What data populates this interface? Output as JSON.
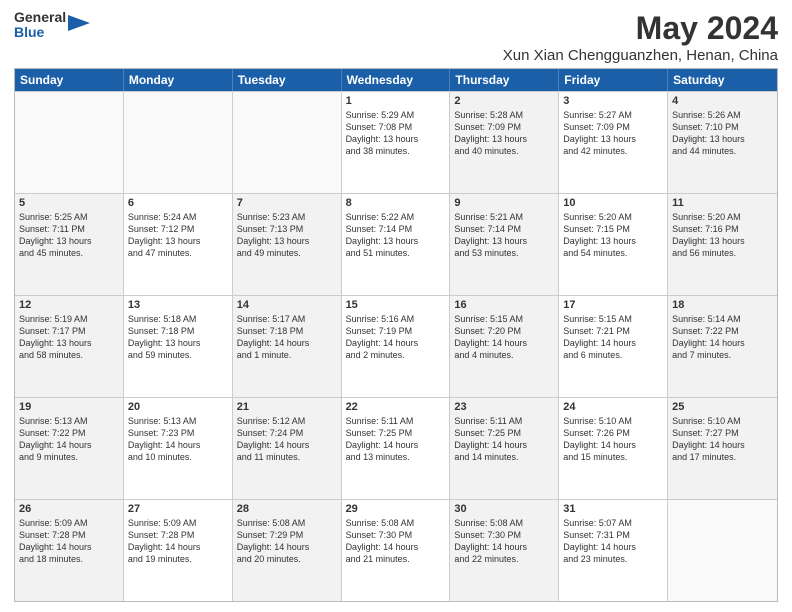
{
  "logo": {
    "general": "General",
    "blue": "Blue"
  },
  "title": "May 2024",
  "subtitle": "Xun Xian Chengguanzhen, Henan, China",
  "headers": [
    "Sunday",
    "Monday",
    "Tuesday",
    "Wednesday",
    "Thursday",
    "Friday",
    "Saturday"
  ],
  "rows": [
    [
      {
        "day": "",
        "text": ""
      },
      {
        "day": "",
        "text": ""
      },
      {
        "day": "",
        "text": ""
      },
      {
        "day": "1",
        "text": "Sunrise: 5:29 AM\nSunset: 7:08 PM\nDaylight: 13 hours\nand 38 minutes."
      },
      {
        "day": "2",
        "text": "Sunrise: 5:28 AM\nSunset: 7:09 PM\nDaylight: 13 hours\nand 40 minutes."
      },
      {
        "day": "3",
        "text": "Sunrise: 5:27 AM\nSunset: 7:09 PM\nDaylight: 13 hours\nand 42 minutes."
      },
      {
        "day": "4",
        "text": "Sunrise: 5:26 AM\nSunset: 7:10 PM\nDaylight: 13 hours\nand 44 minutes."
      }
    ],
    [
      {
        "day": "5",
        "text": "Sunrise: 5:25 AM\nSunset: 7:11 PM\nDaylight: 13 hours\nand 45 minutes."
      },
      {
        "day": "6",
        "text": "Sunrise: 5:24 AM\nSunset: 7:12 PM\nDaylight: 13 hours\nand 47 minutes."
      },
      {
        "day": "7",
        "text": "Sunrise: 5:23 AM\nSunset: 7:13 PM\nDaylight: 13 hours\nand 49 minutes."
      },
      {
        "day": "8",
        "text": "Sunrise: 5:22 AM\nSunset: 7:14 PM\nDaylight: 13 hours\nand 51 minutes."
      },
      {
        "day": "9",
        "text": "Sunrise: 5:21 AM\nSunset: 7:14 PM\nDaylight: 13 hours\nand 53 minutes."
      },
      {
        "day": "10",
        "text": "Sunrise: 5:20 AM\nSunset: 7:15 PM\nDaylight: 13 hours\nand 54 minutes."
      },
      {
        "day": "11",
        "text": "Sunrise: 5:20 AM\nSunset: 7:16 PM\nDaylight: 13 hours\nand 56 minutes."
      }
    ],
    [
      {
        "day": "12",
        "text": "Sunrise: 5:19 AM\nSunset: 7:17 PM\nDaylight: 13 hours\nand 58 minutes."
      },
      {
        "day": "13",
        "text": "Sunrise: 5:18 AM\nSunset: 7:18 PM\nDaylight: 13 hours\nand 59 minutes."
      },
      {
        "day": "14",
        "text": "Sunrise: 5:17 AM\nSunset: 7:18 PM\nDaylight: 14 hours\nand 1 minute."
      },
      {
        "day": "15",
        "text": "Sunrise: 5:16 AM\nSunset: 7:19 PM\nDaylight: 14 hours\nand 2 minutes."
      },
      {
        "day": "16",
        "text": "Sunrise: 5:15 AM\nSunset: 7:20 PM\nDaylight: 14 hours\nand 4 minutes."
      },
      {
        "day": "17",
        "text": "Sunrise: 5:15 AM\nSunset: 7:21 PM\nDaylight: 14 hours\nand 6 minutes."
      },
      {
        "day": "18",
        "text": "Sunrise: 5:14 AM\nSunset: 7:22 PM\nDaylight: 14 hours\nand 7 minutes."
      }
    ],
    [
      {
        "day": "19",
        "text": "Sunrise: 5:13 AM\nSunset: 7:22 PM\nDaylight: 14 hours\nand 9 minutes."
      },
      {
        "day": "20",
        "text": "Sunrise: 5:13 AM\nSunset: 7:23 PM\nDaylight: 14 hours\nand 10 minutes."
      },
      {
        "day": "21",
        "text": "Sunrise: 5:12 AM\nSunset: 7:24 PM\nDaylight: 14 hours\nand 11 minutes."
      },
      {
        "day": "22",
        "text": "Sunrise: 5:11 AM\nSunset: 7:25 PM\nDaylight: 14 hours\nand 13 minutes."
      },
      {
        "day": "23",
        "text": "Sunrise: 5:11 AM\nSunset: 7:25 PM\nDaylight: 14 hours\nand 14 minutes."
      },
      {
        "day": "24",
        "text": "Sunrise: 5:10 AM\nSunset: 7:26 PM\nDaylight: 14 hours\nand 15 minutes."
      },
      {
        "day": "25",
        "text": "Sunrise: 5:10 AM\nSunset: 7:27 PM\nDaylight: 14 hours\nand 17 minutes."
      }
    ],
    [
      {
        "day": "26",
        "text": "Sunrise: 5:09 AM\nSunset: 7:28 PM\nDaylight: 14 hours\nand 18 minutes."
      },
      {
        "day": "27",
        "text": "Sunrise: 5:09 AM\nSunset: 7:28 PM\nDaylight: 14 hours\nand 19 minutes."
      },
      {
        "day": "28",
        "text": "Sunrise: 5:08 AM\nSunset: 7:29 PM\nDaylight: 14 hours\nand 20 minutes."
      },
      {
        "day": "29",
        "text": "Sunrise: 5:08 AM\nSunset: 7:30 PM\nDaylight: 14 hours\nand 21 minutes."
      },
      {
        "day": "30",
        "text": "Sunrise: 5:08 AM\nSunset: 7:30 PM\nDaylight: 14 hours\nand 22 minutes."
      },
      {
        "day": "31",
        "text": "Sunrise: 5:07 AM\nSunset: 7:31 PM\nDaylight: 14 hours\nand 23 minutes."
      },
      {
        "day": "",
        "text": ""
      }
    ]
  ]
}
